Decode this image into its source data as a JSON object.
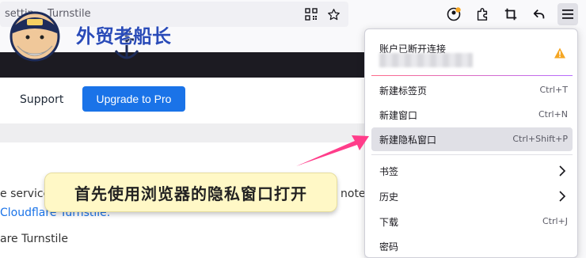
{
  "urlbar": {
    "text": "settin… Turnstile"
  },
  "toolbar_icons": [
    "qr-code-icon",
    "bookmark-star-icon",
    "account-sync-icon",
    "extensions-icon",
    "crop-screenshot-icon",
    "back-reply-icon",
    "hamburger-menu-icon"
  ],
  "logo": {
    "text": "外贸老船长"
  },
  "page": {
    "nav_support": "Support",
    "upgrade_label": "Upgrade to Pro",
    "line_service": "e service",
    "line_note": "note",
    "link_text": "Cloudflare Turnstile.",
    "heading": "are Turnstile"
  },
  "menu": {
    "account_title": "账户已断开连接",
    "items": [
      {
        "label": "新建标签页",
        "shortcut": "Ctrl+T"
      },
      {
        "label": "新建窗口",
        "shortcut": "Ctrl+N"
      },
      {
        "label": "新建隐私窗口",
        "shortcut": "Ctrl+Shift+P"
      },
      {
        "label": "书签",
        "shortcut": ""
      },
      {
        "label": "历史",
        "shortcut": ""
      },
      {
        "label": "下载",
        "shortcut": "Ctrl+J"
      },
      {
        "label": "密码",
        "shortcut": ""
      }
    ]
  },
  "callout": {
    "text": "首先使用浏览器的隐私窗口打开"
  },
  "colors": {
    "accent": "#1a73e8",
    "arrow": "#ff3d8a",
    "warning": "#f5a623",
    "callout_bg": "#fff8c6"
  }
}
